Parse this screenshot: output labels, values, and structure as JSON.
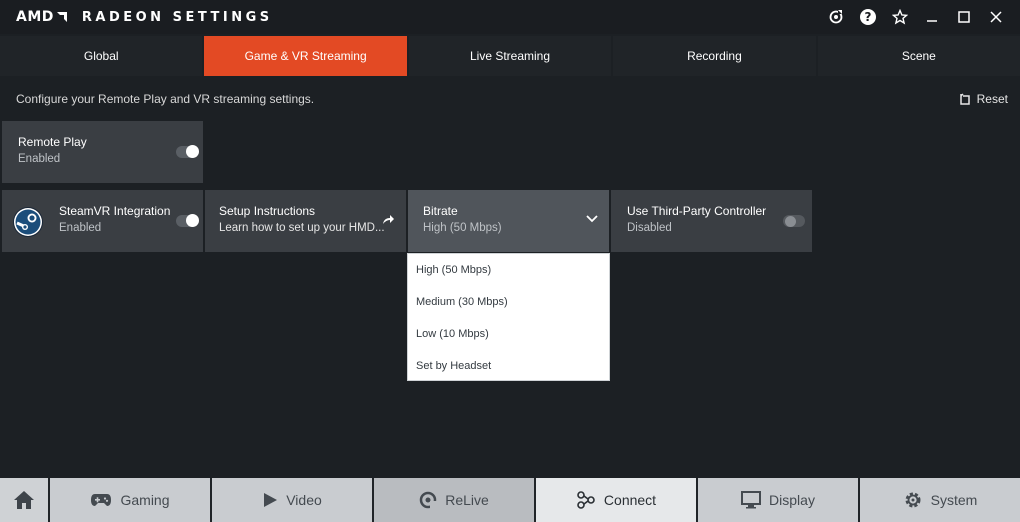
{
  "window": {
    "brand": "AMD",
    "title": "RADEON SETTINGS"
  },
  "tabs": [
    {
      "label": "Global",
      "active": false
    },
    {
      "label": "Game & VR Streaming",
      "active": true
    },
    {
      "label": "Live Streaming",
      "active": false
    },
    {
      "label": "Recording",
      "active": false
    },
    {
      "label": "Scene",
      "active": false
    }
  ],
  "page": {
    "subtitle": "Configure your Remote Play and VR streaming settings.",
    "reset_label": "Reset"
  },
  "tiles": {
    "remote_play": {
      "title": "Remote Play",
      "status": "Enabled",
      "enabled": true
    },
    "steamvr": {
      "title": "SteamVR Integration",
      "status": "Enabled",
      "enabled": true
    },
    "setup": {
      "title": "Setup Instructions",
      "status": "Learn how to set up your HMD..."
    },
    "bitrate": {
      "title": "Bitrate",
      "value": "High (50 Mbps)"
    },
    "controller": {
      "title": "Use Third-Party Controller",
      "status": "Disabled",
      "enabled": false
    }
  },
  "bitrate_options": [
    "High (50 Mbps)",
    "Medium (30 Mbps)",
    "Low (10 Mbps)",
    "Set by Headset"
  ],
  "bottom_nav": [
    {
      "label": "Gaming",
      "icon": "gamepad-icon"
    },
    {
      "label": "Video",
      "icon": "play-icon"
    },
    {
      "label": "ReLive",
      "icon": "relive-icon"
    },
    {
      "label": "Connect",
      "icon": "connect-icon"
    },
    {
      "label": "Display",
      "icon": "monitor-icon"
    },
    {
      "label": "System",
      "icon": "gear-icon"
    }
  ],
  "colors": {
    "accent": "#e34a24",
    "background": "#1c2024",
    "tile": "#3a3e43"
  }
}
